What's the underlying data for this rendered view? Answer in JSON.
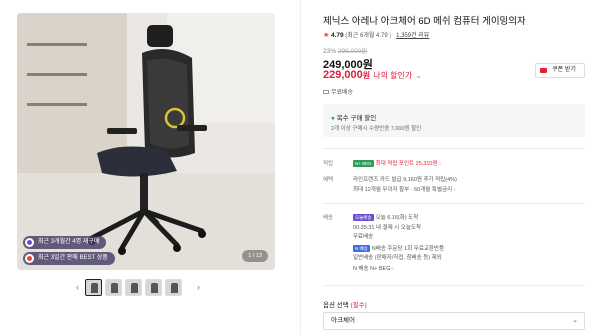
{
  "gallery": {
    "badge_recent_sales": "최근 3개월간 4명 재구매",
    "badge_bestseller": "최근 3일간 판매 BEST 상품",
    "image_counter": "1 / 13",
    "prev_icon": "chevron-left-icon",
    "next_icon": "chevron-right-icon",
    "thumbnail_count": 5
  },
  "product": {
    "title": "제닉스 아레나 아크체어 6D 메쉬 컴퓨터 게이밍의자",
    "rating": "4.79",
    "rating_detail": "(최근 6개월 4.79",
    "review_count": "1,359건 리뷰",
    "discount_rate": "23%",
    "original_price": "299,000원",
    "price": "249,000원",
    "my_price": "229,000",
    "my_price_unit": "원",
    "my_price_label": "나의 할인가",
    "coupon_label": "쿠폰 받기",
    "free_shipping": "무료배송"
  },
  "multi_discount": {
    "title_prefix": "복수 구매 할인",
    "subtitle": "2개 이상 구매시 수량만큼 7,000원 할인"
  },
  "benefits": {
    "points_label": "적립",
    "points_tag": "N+ BEG",
    "points_text": "최대 적립 포인트 25,310원",
    "card_label": "혜택",
    "card_line1": "라인프렌즈 카드 발급 9,160원 추가 적립(4%)",
    "card_line2": "최대 12개월 무이자 할부 · 60개월 특별금리"
  },
  "delivery": {
    "label": "배송",
    "tag": "오늘배송",
    "line1": "오늘 6.16(화) 도착",
    "line2": "00:35:31 내 결제 시 오늘도착",
    "line3": "무료배송",
    "tag2": "N 배송",
    "line4": "N배송 주문당 1회 무료교환반품",
    "line5": "일반배송 (판매자/직접, 참배송 등) 제외",
    "line6": "N 배송 N+ BEG"
  },
  "options": {
    "label": "옵션 선택",
    "required": "(필수)",
    "selected": "아크체어"
  }
}
